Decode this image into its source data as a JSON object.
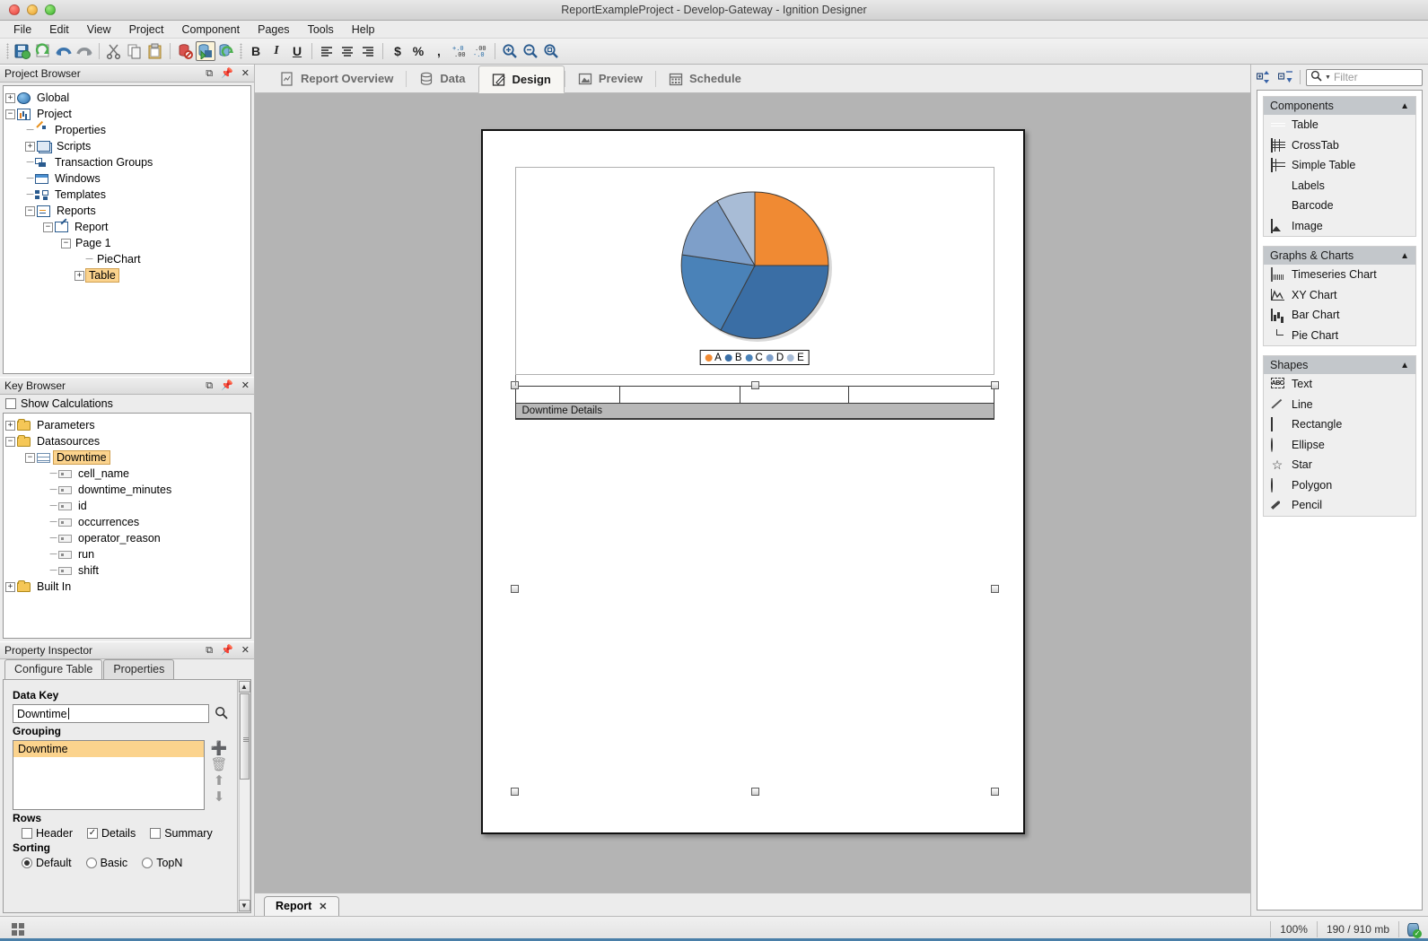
{
  "window": {
    "title": "ReportExampleProject - Develop-Gateway - Ignition Designer"
  },
  "menubar": {
    "items": [
      "File",
      "Edit",
      "View",
      "Project",
      "Component",
      "Pages",
      "Tools",
      "Help"
    ]
  },
  "toolbar": {
    "icons": [
      "save-icon",
      "refresh-icon",
      "undo-icon",
      "redo-icon",
      "cut-icon",
      "copy-icon",
      "paste-icon",
      "db-disabled-icon",
      "db-insert-icon",
      "db-update-icon"
    ],
    "bold_label": "B",
    "italic_label": "I",
    "underline_label": "U",
    "currency_label": "$",
    "percent_label": "%",
    "comma_label": ",",
    "decimal_add_label": "+.0",
    "decimal_remove_label": "-.0"
  },
  "project_browser": {
    "title": "Project Browser",
    "nodes": [
      {
        "label": "Global",
        "icon": "globe-icon",
        "depth": 0,
        "expander": "+"
      },
      {
        "label": "Project",
        "icon": "project-icon",
        "depth": 0,
        "expander": "-"
      },
      {
        "label": "Properties",
        "icon": "properties-icon",
        "depth": 1,
        "expander": ""
      },
      {
        "label": "Scripts",
        "icon": "scripts-icon",
        "depth": 1,
        "expander": "+"
      },
      {
        "label": "Transaction Groups",
        "icon": "transaction-groups-icon",
        "depth": 1,
        "expander": ""
      },
      {
        "label": "Windows",
        "icon": "windows-icon",
        "depth": 1,
        "expander": ""
      },
      {
        "label": "Templates",
        "icon": "templates-icon",
        "depth": 1,
        "expander": ""
      },
      {
        "label": "Reports",
        "icon": "reports-icon",
        "depth": 1,
        "expander": "-"
      },
      {
        "label": "Report",
        "icon": "report-icon",
        "depth": 2,
        "expander": "-"
      },
      {
        "label": "Page 1",
        "icon": "",
        "depth": 3,
        "expander": "-"
      },
      {
        "label": "PieChart",
        "icon": "",
        "depth": 4,
        "expander": ""
      },
      {
        "label": "Table",
        "icon": "",
        "depth": 4,
        "expander": "+",
        "selected": true
      }
    ]
  },
  "key_browser": {
    "title": "Key Browser",
    "show_calculations_label": "Show Calculations",
    "show_calculations_checked": false,
    "nodes": [
      {
        "label": "Parameters",
        "icon": "folder-icon",
        "depth": 0,
        "expander": "+"
      },
      {
        "label": "Datasources",
        "icon": "folder-icon",
        "depth": 0,
        "expander": "-"
      },
      {
        "label": "Downtime",
        "icon": "table-icon",
        "depth": 1,
        "expander": "-",
        "selected": true
      },
      {
        "label": "cell_name",
        "icon": "field-icon",
        "depth": 2,
        "expander": ""
      },
      {
        "label": "downtime_minutes",
        "icon": "field-icon",
        "depth": 2,
        "expander": ""
      },
      {
        "label": "id",
        "icon": "field-icon",
        "depth": 2,
        "expander": ""
      },
      {
        "label": "occurrences",
        "icon": "field-icon",
        "depth": 2,
        "expander": ""
      },
      {
        "label": "operator_reason",
        "icon": "field-icon",
        "depth": 2,
        "expander": ""
      },
      {
        "label": "run",
        "icon": "field-icon",
        "depth": 2,
        "expander": ""
      },
      {
        "label": "shift",
        "icon": "field-icon",
        "depth": 2,
        "expander": ""
      },
      {
        "label": "Built In",
        "icon": "folder-icon",
        "depth": 0,
        "expander": "+"
      }
    ]
  },
  "property_inspector": {
    "title": "Property Inspector",
    "tabs": [
      {
        "label": "Configure Table",
        "active": true
      },
      {
        "label": "Properties",
        "active": false
      }
    ],
    "data_key_label": "Data Key",
    "data_key_value": "Downtime",
    "grouping_label": "Grouping",
    "grouping_items": [
      "Downtime"
    ],
    "grouping_buttons": [
      "add-icon",
      "delete-icon",
      "move-up-icon",
      "move-down-icon"
    ],
    "rows_label": "Rows",
    "rows_options": [
      {
        "label": "Header",
        "checked": false
      },
      {
        "label": "Details",
        "checked": true
      },
      {
        "label": "Summary",
        "checked": false
      }
    ],
    "sorting_label": "Sorting",
    "sorting_options": [
      {
        "label": "Default",
        "selected": true
      },
      {
        "label": "Basic",
        "selected": false
      },
      {
        "label": "TopN",
        "selected": false
      }
    ]
  },
  "report_tabs": [
    {
      "label": "Report Overview",
      "icon": "report-overview-icon",
      "active": false
    },
    {
      "label": "Data",
      "icon": "database-icon",
      "active": false
    },
    {
      "label": "Design",
      "icon": "pencil-square-icon",
      "active": true
    },
    {
      "label": "Preview",
      "icon": "image-icon",
      "active": false
    },
    {
      "label": "Schedule",
      "icon": "calendar-icon",
      "active": false
    }
  ],
  "canvas": {
    "table_component": {
      "band_label": "Downtime Details",
      "column_count": 4
    }
  },
  "chart_data": {
    "type": "pie",
    "title": "",
    "categories": [
      "A",
      "B",
      "C",
      "D",
      "E"
    ],
    "values": [
      25,
      31,
      20,
      16,
      8
    ],
    "colors": [
      "#f08a33",
      "#3a6ea5",
      "#4a82b8",
      "#7e9fc9",
      "#a8bcd6"
    ],
    "legend_position": "bottom",
    "legend_entries": [
      "A",
      "B",
      "C",
      "D",
      "E"
    ]
  },
  "palette": {
    "filter_placeholder": "Filter",
    "toolbar_icons": [
      "expand-all-icon",
      "collapse-all-icon"
    ],
    "sections": [
      {
        "title": "Components",
        "collapse_icon": "chevron-up-icon",
        "items": [
          {
            "label": "Table",
            "icon": "table-icon"
          },
          {
            "label": "CrossTab",
            "icon": "crosstab-icon"
          },
          {
            "label": "Simple Table",
            "icon": "simple-table-icon"
          },
          {
            "label": "Labels",
            "icon": "labels-icon"
          },
          {
            "label": "Barcode",
            "icon": "barcode-icon"
          },
          {
            "label": "Image",
            "icon": "image-icon"
          }
        ]
      },
      {
        "title": "Graphs & Charts",
        "collapse_icon": "chevron-up-icon",
        "items": [
          {
            "label": "Timeseries Chart",
            "icon": "timeseries-chart-icon"
          },
          {
            "label": "XY Chart",
            "icon": "xy-chart-icon"
          },
          {
            "label": "Bar Chart",
            "icon": "bar-chart-icon"
          },
          {
            "label": "Pie Chart",
            "icon": "pie-chart-icon"
          }
        ]
      },
      {
        "title": "Shapes",
        "collapse_icon": "chevron-up-icon",
        "items": [
          {
            "label": "Text",
            "icon": "text-icon"
          },
          {
            "label": "Line",
            "icon": "line-icon"
          },
          {
            "label": "Rectangle",
            "icon": "rectangle-icon"
          },
          {
            "label": "Ellipse",
            "icon": "ellipse-icon"
          },
          {
            "label": "Star",
            "icon": "star-icon"
          },
          {
            "label": "Polygon",
            "icon": "polygon-icon"
          },
          {
            "label": "Pencil",
            "icon": "pencil-icon"
          }
        ]
      }
    ]
  },
  "bottom_tab": {
    "label": "Report",
    "close_label": "✕"
  },
  "statusbar": {
    "zoom": "100%",
    "memory": "190 / 910 mb",
    "db_icon": "database-ok-icon"
  }
}
